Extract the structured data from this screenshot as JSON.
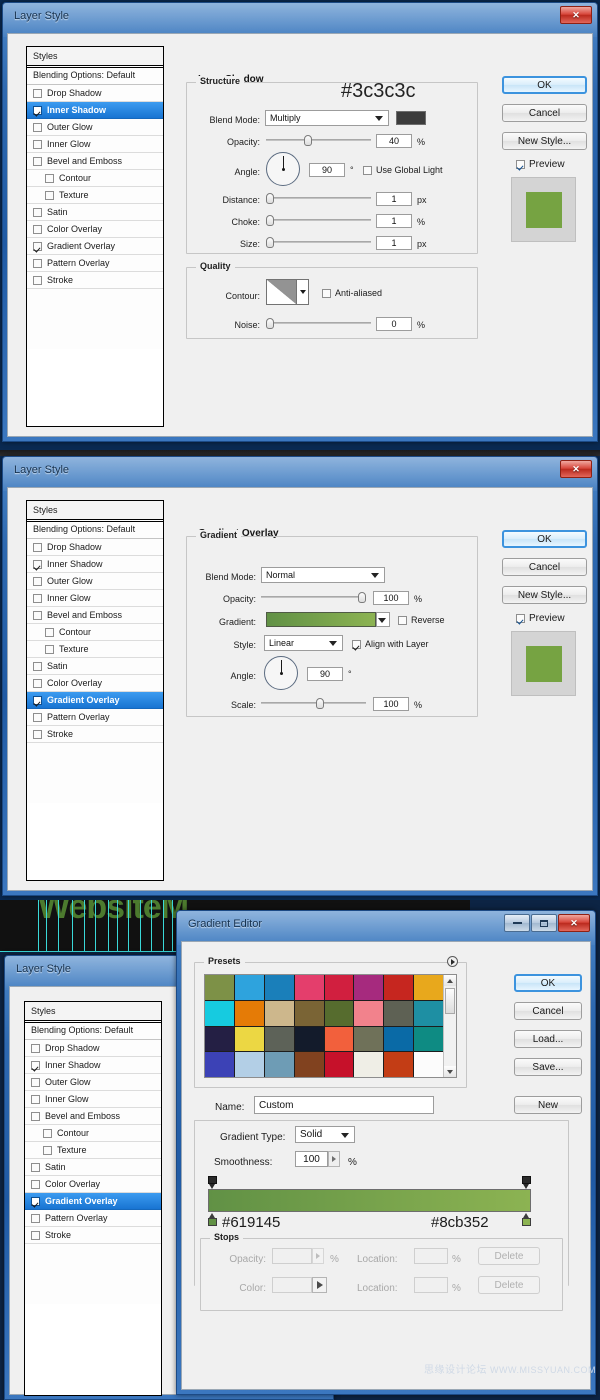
{
  "common": {
    "styles_header": "Styles",
    "blending_options": "Blending Options: Default",
    "style_items": [
      {
        "label": "Drop Shadow",
        "checked": false,
        "indent": false
      },
      {
        "label": "Inner Shadow",
        "checked": true,
        "indent": false
      },
      {
        "label": "Outer Glow",
        "checked": false,
        "indent": false
      },
      {
        "label": "Inner Glow",
        "checked": false,
        "indent": false
      },
      {
        "label": "Bevel and Emboss",
        "checked": false,
        "indent": false
      },
      {
        "label": "Contour",
        "checked": false,
        "indent": true
      },
      {
        "label": "Texture",
        "checked": false,
        "indent": true
      },
      {
        "label": "Satin",
        "checked": false,
        "indent": false
      },
      {
        "label": "Color Overlay",
        "checked": false,
        "indent": false
      },
      {
        "label": "Gradient Overlay",
        "checked": true,
        "indent": false
      },
      {
        "label": "Pattern Overlay",
        "checked": false,
        "indent": false
      },
      {
        "label": "Stroke",
        "checked": false,
        "indent": false
      }
    ],
    "buttons": {
      "ok": "OK",
      "cancel": "Cancel",
      "new_style": "New Style...",
      "preview": "Preview"
    },
    "preview_swatch_color": "#76a342"
  },
  "panel1": {
    "window_title": "Layer Style",
    "close_icon": "close-icon",
    "selected_style": "Inner Shadow",
    "section_title": "Inner Shadow",
    "structure": {
      "legend": "Structure",
      "hex_note": "#3c3c3c",
      "blend_mode_label": "Blend Mode:",
      "blend_mode_value": "Multiply",
      "shadow_color": "#3c3c3c",
      "opacity_label": "Opacity:",
      "opacity_value": "40",
      "opacity_unit": "%",
      "angle_label": "Angle:",
      "angle_value": "90",
      "angle_unit": "°",
      "use_global_light": "Use Global Light",
      "use_global_light_checked": false,
      "distance_label": "Distance:",
      "distance_value": "1",
      "distance_unit": "px",
      "choke_label": "Choke:",
      "choke_value": "1",
      "choke_unit": "%",
      "size_label": "Size:",
      "size_value": "1",
      "size_unit": "px"
    },
    "quality": {
      "legend": "Quality",
      "contour_label": "Contour:",
      "anti_aliased": "Anti-aliased",
      "anti_aliased_checked": false,
      "noise_label": "Noise:",
      "noise_value": "0",
      "noise_unit": "%"
    }
  },
  "panel2": {
    "window_title": "Layer Style",
    "selected_style": "Gradient Overlay",
    "section_title": "Gradient Overlay",
    "gradient": {
      "legend": "Gradient",
      "blend_mode_label": "Blend Mode:",
      "blend_mode_value": "Normal",
      "opacity_label": "Opacity:",
      "opacity_value": "100",
      "opacity_unit": "%",
      "gradient_label": "Gradient:",
      "gradient_from": "#619145",
      "gradient_to": "#8cb352",
      "reverse_label": "Reverse",
      "reverse_checked": false,
      "style_label": "Style:",
      "style_value": "Linear",
      "align_with_layer": "Align with Layer",
      "align_checked": true,
      "angle_label": "Angle:",
      "angle_value": "90",
      "angle_unit": "°",
      "scale_label": "Scale:",
      "scale_value": "100",
      "scale_unit": "%"
    }
  },
  "panel3": {
    "background_text": "WebsiteM",
    "layer_style": {
      "window_title": "Layer Style",
      "selected_style": "Gradient Overlay"
    },
    "gradient_editor": {
      "window_title": "Gradient Editor",
      "minimize_icon": "minimize-icon",
      "maximize_icon": "maximize-icon",
      "close_icon": "close-icon",
      "presets_legend": "Presets",
      "presets_menu_icon": "presets-menu-icon",
      "preset_colors": [
        "#7d9147",
        "#2ea3dd",
        "#1a7fba",
        "#e43e6c",
        "#d11f3f",
        "#a62a7e",
        "#c6261f",
        "#e8a81c",
        "#16cbe0",
        "#e57b06",
        "#cdb78c",
        "#7a6435",
        "#566c2e",
        "#f2828c",
        "#5e6154",
        "#1e8fa3",
        "#241f44",
        "#ecd743",
        "#5d6258",
        "#131b2b",
        "#f2603c",
        "#6f7159",
        "#0a6aa6",
        "#0e8b83",
        "#3c42b6",
        "#b3cfe6",
        "#6e9cb5",
        "#81421f",
        "#c6112a",
        "#efeee6",
        "#c33d15",
        "#fcfcfc"
      ],
      "buttons": {
        "ok": "OK",
        "cancel": "Cancel",
        "load": "Load...",
        "save": "Save...",
        "new": "New"
      },
      "name_label": "Name:",
      "name_value": "Custom",
      "gradient_type_label": "Gradient Type:",
      "gradient_type_value": "Solid",
      "smoothness_label": "Smoothness:",
      "smoothness_value": "100",
      "smoothness_unit": "%",
      "gradient_from": "#619145",
      "gradient_to": "#8cb352",
      "stop_left_hex": "#619145",
      "stop_right_hex": "#8cb352",
      "stops": {
        "legend": "Stops",
        "opacity_label": "Opacity:",
        "opacity_value": "",
        "opacity_unit": "%",
        "opacity_location_label": "Location:",
        "opacity_location_value": "",
        "opacity_location_unit": "%",
        "delete_opacity": "Delete",
        "color_label": "Color:",
        "color_location_label": "Location:",
        "color_location_value": "",
        "color_location_unit": "%",
        "delete_color": "Delete"
      }
    },
    "watermark_cn": "思缘设计论坛",
    "watermark_url": "WWW.MISSYUAN.COM"
  }
}
